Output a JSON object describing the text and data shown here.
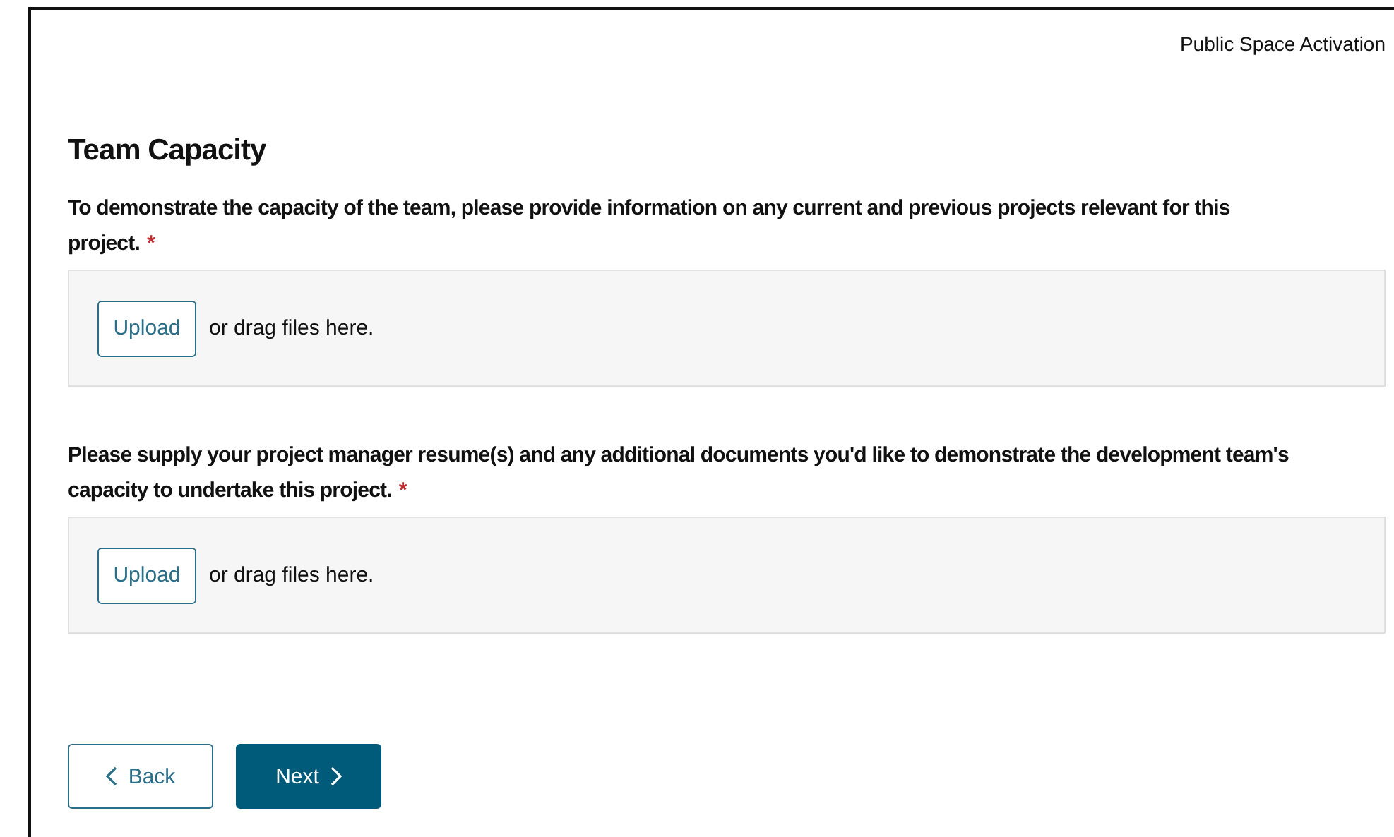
{
  "header": {
    "form_title": "Public Space Activation"
  },
  "section": {
    "title": "Team Capacity"
  },
  "questions": [
    {
      "label": "To demonstrate the capacity of the team, please provide information on any current and previous projects relevant for this project.",
      "required_mark": "*",
      "upload_button": "Upload",
      "drop_hint": "or drag files here."
    },
    {
      "label": "Please supply your project manager resume(s) and any additional documents you'd like to demonstrate the development team's capacity to undertake this project.",
      "required_mark": "*",
      "upload_button": "Upload",
      "drop_hint": "or drag files here."
    }
  ],
  "buttons": [
    {
      "kind": "back",
      "label": "Back"
    },
    {
      "kind": "next",
      "label": "Next"
    }
  ]
}
